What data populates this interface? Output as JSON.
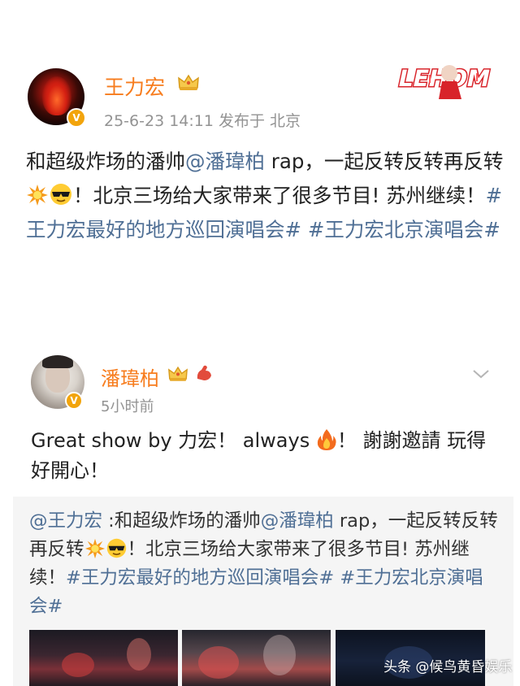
{
  "post1": {
    "author": "王力宏",
    "meta": "25-6-23 14:11  发布于 北京",
    "text_parts": {
      "a": "和超级炸场的潘帅",
      "mention": "@潘瑋柏",
      "b": " rap，一起反转反转再反转",
      "c": "！北京三场给大家带来了很多节目! 苏州继续！",
      "tag1": "#王力宏最好的地方巡回演唱会#",
      "tag2": " #王力宏北京演唱会#"
    }
  },
  "post2": {
    "author": "潘瑋柏",
    "meta": "5小时前",
    "text_parts": {
      "a": "Great show by 力宏！ always ",
      "b": "！  謝謝邀請 玩得好開心！"
    }
  },
  "repost": {
    "author_mention": "@王力宏",
    "text_parts": {
      "a": " :和超级炸场的潘帅",
      "mention": "@潘瑋柏",
      "b": " rap，一起反转反转再反转",
      "c": "！北京三场给大家带来了很多节目! 苏州继续！",
      "tag1": "#王力宏最好的地方巡回演唱会#",
      "tag2": " #王力宏北京演唱会#"
    }
  },
  "watermark": "头条 @候鸟黄昏娱乐",
  "icons": {
    "verified": "verified-badge-icon",
    "crown": "crown-icon",
    "chevron": "chevron-down-icon",
    "boom": "collision-emoji",
    "cool": "sunglasses-emoji",
    "fire": "fire-emoji"
  },
  "colors": {
    "name": "#f77c1d",
    "link": "#4f6f95",
    "meta": "#939393",
    "verified": "#f2a40c"
  }
}
